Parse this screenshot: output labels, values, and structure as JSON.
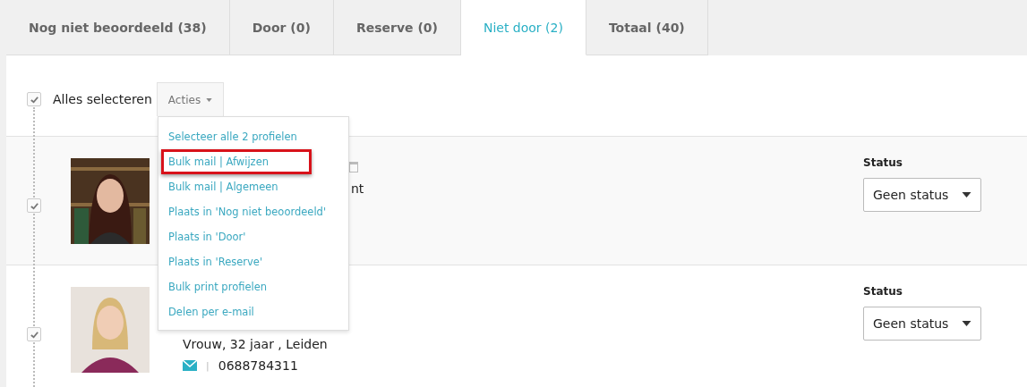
{
  "tabs": [
    {
      "label": "Nog niet beoordeeld (38)",
      "selected": false
    },
    {
      "label": "Door (0)",
      "selected": false
    },
    {
      "label": "Reserve (0)",
      "selected": false
    },
    {
      "label": "Niet door (2)",
      "selected": true
    },
    {
      "label": "Totaal (40)",
      "selected": false
    }
  ],
  "select_all": {
    "label": "Alles selecteren",
    "checked": true
  },
  "actions_button": {
    "label": "Acties"
  },
  "actions_menu": [
    {
      "label": "Selecteer alle 2 profielen",
      "highlighted": false
    },
    {
      "label": "Bulk mail | Afwijzen",
      "highlighted": true
    },
    {
      "label": "Bulk mail | Algemeen",
      "highlighted": false
    },
    {
      "label": "Plaats in 'Nog niet beoordeeld'",
      "highlighted": false
    },
    {
      "label": "Plaats in 'Door'",
      "highlighted": false
    },
    {
      "label": "Plaats in 'Reserve'",
      "highlighted": false
    },
    {
      "label": "Bulk print profielen",
      "highlighted": false
    },
    {
      "label": "Delen per e-mail",
      "highlighted": false
    }
  ],
  "candidates": [
    {
      "checked": true,
      "lines": [
        "nt"
      ],
      "status_label": "Status",
      "status": "Geen status"
    },
    {
      "checked": true,
      "lines": [
        "Vrouw, 32 jaar , Leiden"
      ],
      "phone": "0688784311",
      "separator": "|",
      "status_label": "Status",
      "status": "Geen status"
    }
  ]
}
